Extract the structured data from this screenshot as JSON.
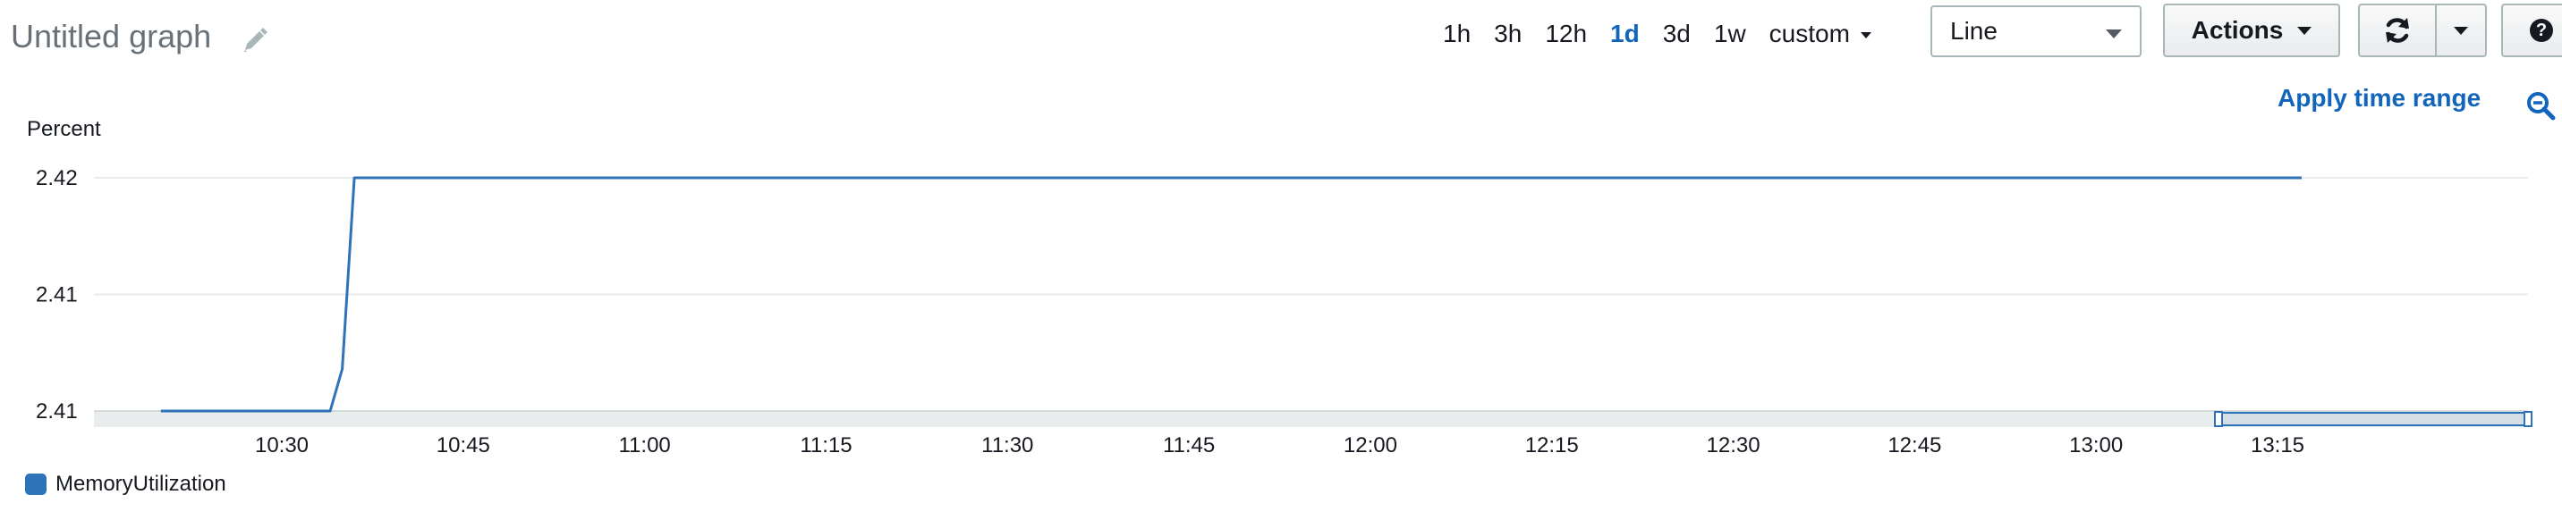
{
  "header": {
    "title": "Untitled graph",
    "periods": [
      "1h",
      "3h",
      "12h",
      "1d",
      "3d",
      "1w"
    ],
    "active_period": "1d",
    "custom_label": "custom",
    "chart_type_value": "Line",
    "actions_label": "Actions"
  },
  "toolbar": {
    "apply_time_range": "Apply time range"
  },
  "colors": {
    "series": "#2e73b8",
    "link": "#1166bb",
    "title": "#687078"
  },
  "icons": [
    "pencil-icon",
    "refresh-icon",
    "chevron-down-icon",
    "help-icon",
    "zoom-out-icon"
  ],
  "chart_data": {
    "type": "line",
    "ylabel": "Percent",
    "y_tick_labels": [
      "2.42",
      "2.41",
      "2.41"
    ],
    "y_tick_values": [
      2.42,
      2.415,
      2.41
    ],
    "ylim": [
      2.41,
      2.42
    ],
    "x_tick_labels": [
      "10:30",
      "10:45",
      "11:00",
      "11:15",
      "11:30",
      "11:45",
      "12:00",
      "12:15",
      "12:30",
      "12:45",
      "13:00",
      "13:15"
    ],
    "grid": true,
    "legend_position": "bottom-left",
    "series": [
      {
        "name": "MemoryUtilization",
        "x": [
          "10:20",
          "10:34",
          "10:35",
          "10:36",
          "13:17"
        ],
        "values": [
          2.41,
          2.41,
          2.4118,
          2.42,
          2.42
        ]
      }
    ]
  }
}
